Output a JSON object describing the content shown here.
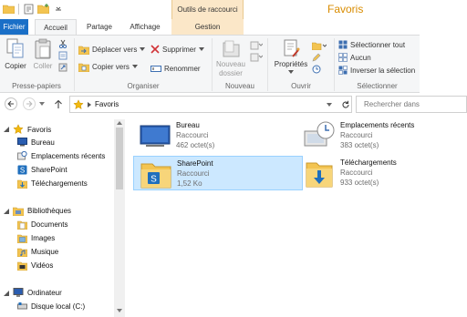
{
  "window": {
    "title": "Favoris",
    "contextual_group": "Outils de raccourci"
  },
  "tabs": [
    {
      "label": "Fichier"
    },
    {
      "label": "Accueil"
    },
    {
      "label": "Partage"
    },
    {
      "label": "Affichage"
    },
    {
      "label": "Gestion"
    }
  ],
  "ribbon": {
    "presse_papiers": {
      "label": "Presse-papiers",
      "copy": "Copier",
      "paste": "Coller"
    },
    "organiser": {
      "label": "Organiser",
      "move_to": "Déplacer vers",
      "copy_to": "Copier vers",
      "delete": "Supprimer",
      "rename": "Renommer"
    },
    "nouveau": {
      "label": "Nouveau",
      "new_folder_line1": "Nouveau",
      "new_folder_line2": "dossier"
    },
    "ouvrir": {
      "label": "Ouvrir",
      "properties": "Propriétés"
    },
    "selectionner": {
      "label": "Sélectionner",
      "select_all": "Sélectionner tout",
      "select_none": "Aucun",
      "invert": "Inverser la sélection"
    }
  },
  "address": {
    "location": "Favoris",
    "search_placeholder": "Rechercher dans"
  },
  "nav": {
    "favorites": {
      "label": "Favoris",
      "items": [
        "Bureau",
        "Emplacements récents",
        "SharePoint",
        "Téléchargements"
      ]
    },
    "libraries": {
      "label": "Bibliothèques",
      "items": [
        "Documents",
        "Images",
        "Musique",
        "Vidéos"
      ]
    },
    "computer": {
      "label": "Ordinateur",
      "items": [
        "Disque local (C:)"
      ]
    }
  },
  "files": [
    {
      "name": "Bureau",
      "type": "Raccourci",
      "size": "462 octet(s)",
      "icon": "desktop-icon"
    },
    {
      "name": "Emplacements récents",
      "type": "Raccourci",
      "size": "383 octet(s)",
      "icon": "recent-places-icon"
    },
    {
      "name": "SharePoint",
      "type": "Raccourci",
      "size": "1,52 Ko",
      "icon": "sharepoint-folder-icon",
      "selected": true
    },
    {
      "name": "Téléchargements",
      "type": "Raccourci",
      "size": "933 octet(s)",
      "icon": "downloads-folder-icon"
    }
  ],
  "colors": {
    "accent": "#1a6fc7",
    "title": "#d98c00",
    "contextual": "#fbe7c8",
    "selection": "#cce8ff"
  }
}
